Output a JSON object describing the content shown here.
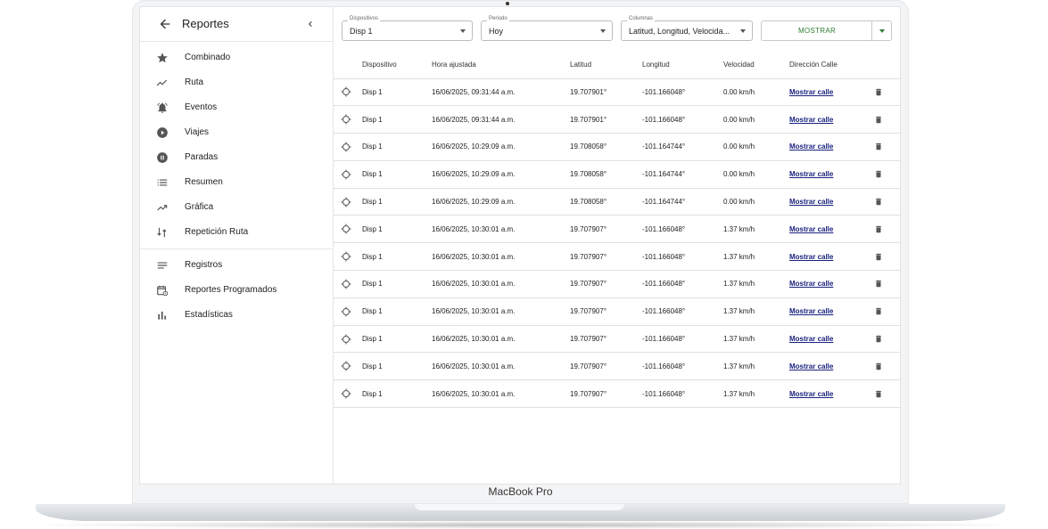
{
  "device_label": "MacBook Pro",
  "sidebar": {
    "title": "Reportes",
    "back_icon": "arrow-left-icon",
    "collapse_icon": "chevron-left-icon",
    "items": [
      {
        "label": "Combinado",
        "icon": "star-icon"
      },
      {
        "label": "Ruta",
        "icon": "timeline-icon"
      },
      {
        "label": "Eventos",
        "icon": "bell-icon"
      },
      {
        "label": "Viajes",
        "icon": "play-circle-icon"
      },
      {
        "label": "Paradas",
        "icon": "pause-circle-icon"
      },
      {
        "label": "Resumen",
        "icon": "list-icon"
      },
      {
        "label": "Gráfica",
        "icon": "trending-up-icon"
      },
      {
        "label": "Repetición Ruta",
        "icon": "route-replay-icon"
      }
    ],
    "items2": [
      {
        "label": "Registros",
        "icon": "notes-icon"
      },
      {
        "label": "Reportes Programados",
        "icon": "calendar-clock-icon"
      },
      {
        "label": "Estadísticas",
        "icon": "bar-chart-icon"
      }
    ]
  },
  "filters": {
    "dispositivos": {
      "legend": "Dispositivos",
      "value": "Disp 1"
    },
    "periodo": {
      "legend": "Periodo",
      "value": "Hoy"
    },
    "columnas": {
      "legend": "Columnas",
      "value": "Latitud, Longitud, Velocida..."
    },
    "mostrar_label": "MOSTRAR"
  },
  "table": {
    "headers": [
      "Dispositivo",
      "Hora ajustada",
      "Latitud",
      "Longitud",
      "Velocidad",
      "Dirección Calle"
    ],
    "link_label": "Mostrar calle",
    "rows": [
      [
        "Disp 1",
        "16/06/2025, 09:31:44 a.m.",
        "19.707901°",
        "-101.166048°",
        "0.00 km/h"
      ],
      [
        "Disp 1",
        "16/06/2025, 09:31:44 a.m.",
        "19.707901°",
        "-101.166048°",
        "0.00 km/h"
      ],
      [
        "Disp 1",
        "16/06/2025, 10:29:09 a.m.",
        "19.708058°",
        "-101.164744°",
        "0.00 km/h"
      ],
      [
        "Disp 1",
        "16/06/2025, 10:29:09 a.m.",
        "19.708058°",
        "-101.164744°",
        "0.00 km/h"
      ],
      [
        "Disp 1",
        "16/06/2025, 10:29:09 a.m.",
        "19.708058°",
        "-101.164744°",
        "0.00 km/h"
      ],
      [
        "Disp 1",
        "16/06/2025, 10:30:01 a.m.",
        "19.707907°",
        "-101.166048°",
        "1.37 km/h"
      ],
      [
        "Disp 1",
        "16/06/2025, 10:30:01 a.m.",
        "19.707907°",
        "-101.166048°",
        "1.37 km/h"
      ],
      [
        "Disp 1",
        "16/06/2025, 10:30:01 a.m.",
        "19.707907°",
        "-101.166048°",
        "1.37 km/h"
      ],
      [
        "Disp 1",
        "16/06/2025, 10:30:01 a.m.",
        "19.707907°",
        "-101.166048°",
        "1.37 km/h"
      ],
      [
        "Disp 1",
        "16/06/2025, 10:30:01 a.m.",
        "19.707907°",
        "-101.166048°",
        "1.37 km/h"
      ],
      [
        "Disp 1",
        "16/06/2025, 10:30:01 a.m.",
        "19.707907°",
        "-101.166048°",
        "1.37 km/h"
      ],
      [
        "Disp 1",
        "16/06/2025, 10:30:01 a.m.",
        "19.707907°",
        "-101.166048°",
        "1.37 km/h"
      ]
    ]
  }
}
